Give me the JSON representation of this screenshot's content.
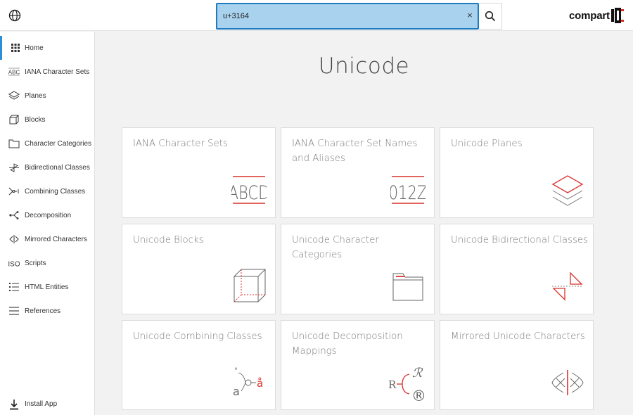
{
  "header": {
    "globe_icon": "globe-icon",
    "search": {
      "value": "u+3164",
      "placeholder": ""
    },
    "clear_label": "×",
    "brand": "compart"
  },
  "sidebar": {
    "items": [
      {
        "label": "Home",
        "icon": "grid-icon",
        "active": true
      },
      {
        "label": "IANA Character Sets",
        "icon": "iana-abc-icon"
      },
      {
        "label": "Planes",
        "icon": "layers-icon"
      },
      {
        "label": "Blocks",
        "icon": "cube-icon"
      },
      {
        "label": "Character Categories",
        "icon": "folder-icon"
      },
      {
        "label": "Bidirectional Classes",
        "icon": "bidi-arrows-icon"
      },
      {
        "label": "Combining Classes",
        "icon": "combining-icon"
      },
      {
        "label": "Decomposition",
        "icon": "decomposition-icon"
      },
      {
        "label": "Mirrored Characters",
        "icon": "mirror-icon"
      },
      {
        "label": "Scripts",
        "icon": "iso-icon"
      },
      {
        "label": "HTML Entities",
        "icon": "list-icon"
      },
      {
        "label": "References",
        "icon": "menu-lines-icon"
      }
    ],
    "install_label": "Install App"
  },
  "main": {
    "title": "Unicode",
    "cards": [
      {
        "title": "IANA Character Sets",
        "art_text": "ABCD",
        "icon": "abcd-icon"
      },
      {
        "title": "IANA Character Set Names and Aliases",
        "art_text": "012Z",
        "icon": "012z-icon"
      },
      {
        "title": "Unicode Planes",
        "icon": "layers-icon"
      },
      {
        "title": "Unicode Blocks",
        "icon": "cube-icon"
      },
      {
        "title": "Unicode Character Categories",
        "icon": "folder-icon"
      },
      {
        "title": "Unicode Bidirectional Classes",
        "icon": "bidi-triangles-icon"
      },
      {
        "title": "Unicode Combining Classes",
        "icon": "combining-icon",
        "art_letters": [
          "°",
          "a",
          "å"
        ]
      },
      {
        "title": "Unicode Decomposition Mappings",
        "icon": "decomposition-icon",
        "art_letters": [
          "R",
          "ℛ",
          "®"
        ]
      },
      {
        "title": "Mirrored Unicode Characters",
        "icon": "mirror-icon"
      }
    ]
  },
  "colors": {
    "accent": "#d9322b",
    "focus": "#1e7bbf",
    "active": "#2a8fd6"
  }
}
